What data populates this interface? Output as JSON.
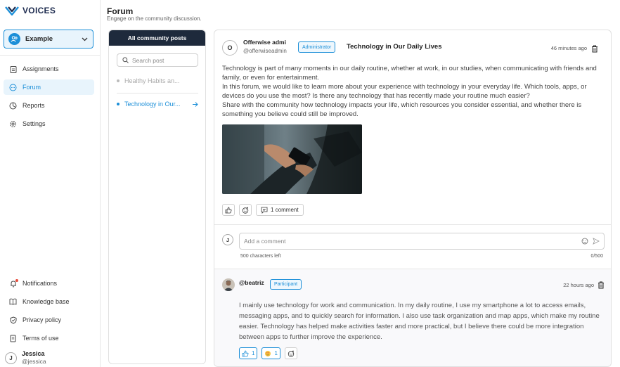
{
  "app": {
    "name": "VOICES"
  },
  "workspace": {
    "label": "Example"
  },
  "nav": {
    "items": [
      {
        "label": "Assignments",
        "icon": "clipboard-icon"
      },
      {
        "label": "Forum",
        "icon": "chat-icon",
        "active": true
      },
      {
        "label": "Reports",
        "icon": "chart-icon"
      },
      {
        "label": "Settings",
        "icon": "gear-icon"
      }
    ],
    "bottom": [
      {
        "label": "Notifications",
        "icon": "bell-icon"
      },
      {
        "label": "Knowledge base",
        "icon": "book-icon"
      },
      {
        "label": "Privacy policy",
        "icon": "shield-icon"
      },
      {
        "label": "Terms of use",
        "icon": "document-icon"
      }
    ]
  },
  "user": {
    "initial": "J",
    "name": "Jessica",
    "handle": "@jessica"
  },
  "header": {
    "title": "Forum",
    "subtitle": "Engage on the community discussion."
  },
  "posts_list": {
    "header": "All community posts",
    "search_placeholder": "Search post",
    "items": [
      {
        "title": "Healthy Habits an...",
        "active": false
      },
      {
        "title": "Technology in Our...",
        "active": true
      }
    ]
  },
  "post": {
    "author_initial": "O",
    "author_name": "Offerwise admi",
    "author_handle": "@offerwiseadmin",
    "role": "Administrator",
    "title": "Technology in Our Daily Lives",
    "time": "46 minutes ago",
    "paragraphs": [
      "Technology is part of many moments in our daily routine, whether at work, in our studies, when communicating with friends and family, or even for entertainment.",
      "In this forum, we would like to learn more about your experience with technology in your everyday life. Which tools, apps, or devices do you use the most? Is there any technology that has recently made your routine much easier?",
      "Share with the community how technology impacts your life, which resources you consider essential, and whether there is something you believe could still be improved."
    ],
    "comment_button": "1 comment"
  },
  "comment_box": {
    "avatar_initial": "J",
    "placeholder": "Add a comment",
    "remaining": "500 characters left",
    "count": "0/500"
  },
  "reply": {
    "author": "@beatriz",
    "role": "Participant",
    "time": "22 hours ago",
    "body": "I mainly use technology for work and communication. In my daily routine, I use my smartphone a lot to access emails, messaging apps, and to quickly search for information. I also use task organization and map apps, which make my routine easier. Technology has helped make activities faster and more practical, but I believe there could be more integration between apps to further improve the experience.",
    "like_count": "1",
    "love_count": "1"
  },
  "colors": {
    "accent": "#1c8fd8",
    "dark": "#1e2a3c"
  }
}
